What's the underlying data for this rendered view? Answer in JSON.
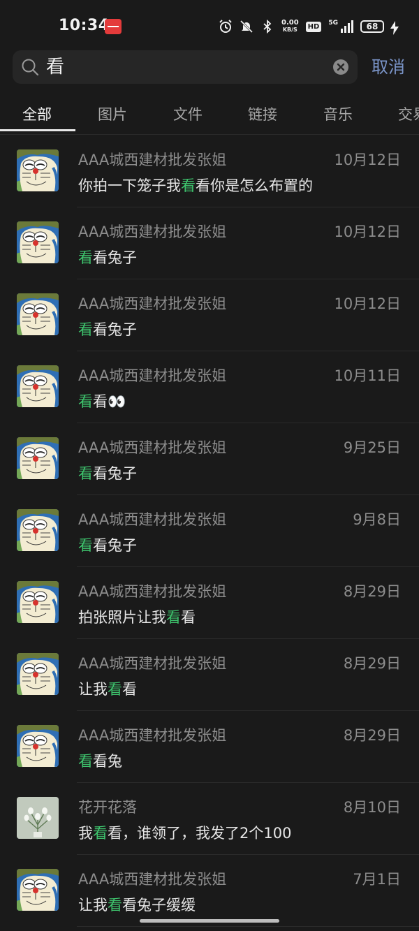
{
  "status_bar": {
    "time": "10:34",
    "net_speed_top": "0.00",
    "net_speed_bottom": "KB/S",
    "hd": "HD",
    "network": "5G",
    "battery": "68"
  },
  "search": {
    "query": "看",
    "cancel_label": "取消"
  },
  "tabs": [
    {
      "label": "全部",
      "active": true
    },
    {
      "label": "图片"
    },
    {
      "label": "文件"
    },
    {
      "label": "链接"
    },
    {
      "label": "音乐"
    },
    {
      "label": "交易"
    }
  ],
  "colors": {
    "highlight": "#3ec46d",
    "accent_link": "#7b95c9"
  },
  "results": [
    {
      "avatar": "doraemon",
      "name": "AAA城西建材批发张姐",
      "date": "10月12日",
      "msg": [
        [
          "你拍一下笼子我",
          false
        ],
        [
          "看",
          true
        ],
        [
          "看你是怎么布置的",
          false
        ]
      ]
    },
    {
      "avatar": "doraemon",
      "name": "AAA城西建材批发张姐",
      "date": "10月12日",
      "msg": [
        [
          "看",
          true
        ],
        [
          "看兔子",
          false
        ]
      ]
    },
    {
      "avatar": "doraemon",
      "name": "AAA城西建材批发张姐",
      "date": "10月12日",
      "msg": [
        [
          "看",
          true
        ],
        [
          "看兔子",
          false
        ]
      ]
    },
    {
      "avatar": "doraemon",
      "name": "AAA城西建材批发张姐",
      "date": "10月11日",
      "msg": [
        [
          "看",
          true
        ],
        [
          "看👀",
          false
        ]
      ]
    },
    {
      "avatar": "doraemon",
      "name": "AAA城西建材批发张姐",
      "date": "9月25日",
      "msg": [
        [
          "看",
          true
        ],
        [
          "看兔子",
          false
        ]
      ]
    },
    {
      "avatar": "doraemon",
      "name": "AAA城西建材批发张姐",
      "date": "9月8日",
      "msg": [
        [
          "看",
          true
        ],
        [
          "看兔子",
          false
        ]
      ]
    },
    {
      "avatar": "doraemon",
      "name": "AAA城西建材批发张姐",
      "date": "8月29日",
      "msg": [
        [
          "拍张照片让我",
          false
        ],
        [
          "看",
          true
        ],
        [
          "看",
          false
        ]
      ]
    },
    {
      "avatar": "doraemon",
      "name": "AAA城西建材批发张姐",
      "date": "8月29日",
      "msg": [
        [
          "让我",
          false
        ],
        [
          "看",
          true
        ],
        [
          "看",
          false
        ]
      ]
    },
    {
      "avatar": "doraemon",
      "name": "AAA城西建材批发张姐",
      "date": "8月29日",
      "msg": [
        [
          "看",
          true
        ],
        [
          "看兔",
          false
        ]
      ]
    },
    {
      "avatar": "flower",
      "name": "花开花落",
      "date": "8月10日",
      "msg": [
        [
          "我",
          false
        ],
        [
          "看",
          true
        ],
        [
          "看，谁领了，我发了2个100",
          false
        ]
      ]
    },
    {
      "avatar": "doraemon",
      "name": "AAA城西建材批发张姐",
      "date": "7月1日",
      "msg": [
        [
          "让我",
          false
        ],
        [
          "看",
          true
        ],
        [
          "看兔子缓缓",
          false
        ]
      ]
    }
  ]
}
